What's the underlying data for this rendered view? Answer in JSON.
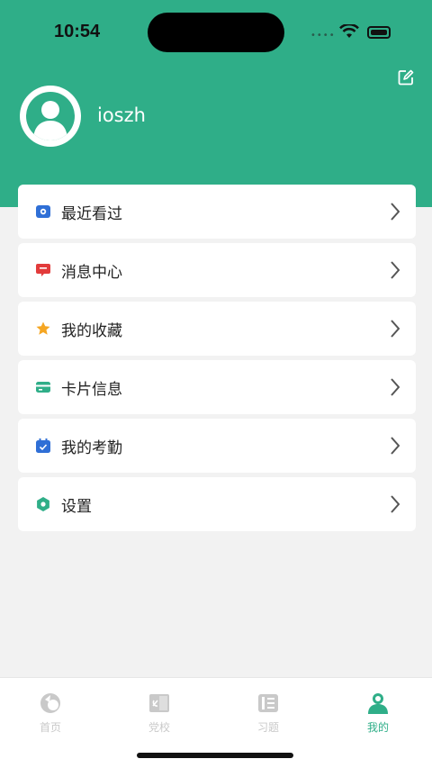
{
  "status": {
    "time": "10:54"
  },
  "profile": {
    "username": "ioszh"
  },
  "menu": [
    {
      "label": "最近看过",
      "icon": "history-icon",
      "color": "#2f6fd6"
    },
    {
      "label": "消息中心",
      "icon": "message-icon",
      "color": "#e23b3b"
    },
    {
      "label": "我的收藏",
      "icon": "star-icon",
      "color": "#f5a623"
    },
    {
      "label": "卡片信息",
      "icon": "card-icon",
      "color": "#2fae88"
    },
    {
      "label": "我的考勤",
      "icon": "calendar-icon",
      "color": "#2f6fd6"
    },
    {
      "label": "设置",
      "icon": "gear-icon",
      "color": "#2fae88"
    }
  ],
  "tabs": [
    {
      "label": "首页"
    },
    {
      "label": "党校"
    },
    {
      "label": "习题"
    },
    {
      "label": "我的"
    }
  ],
  "colors": {
    "accent": "#2fae88",
    "background": "#f2f2f2"
  }
}
